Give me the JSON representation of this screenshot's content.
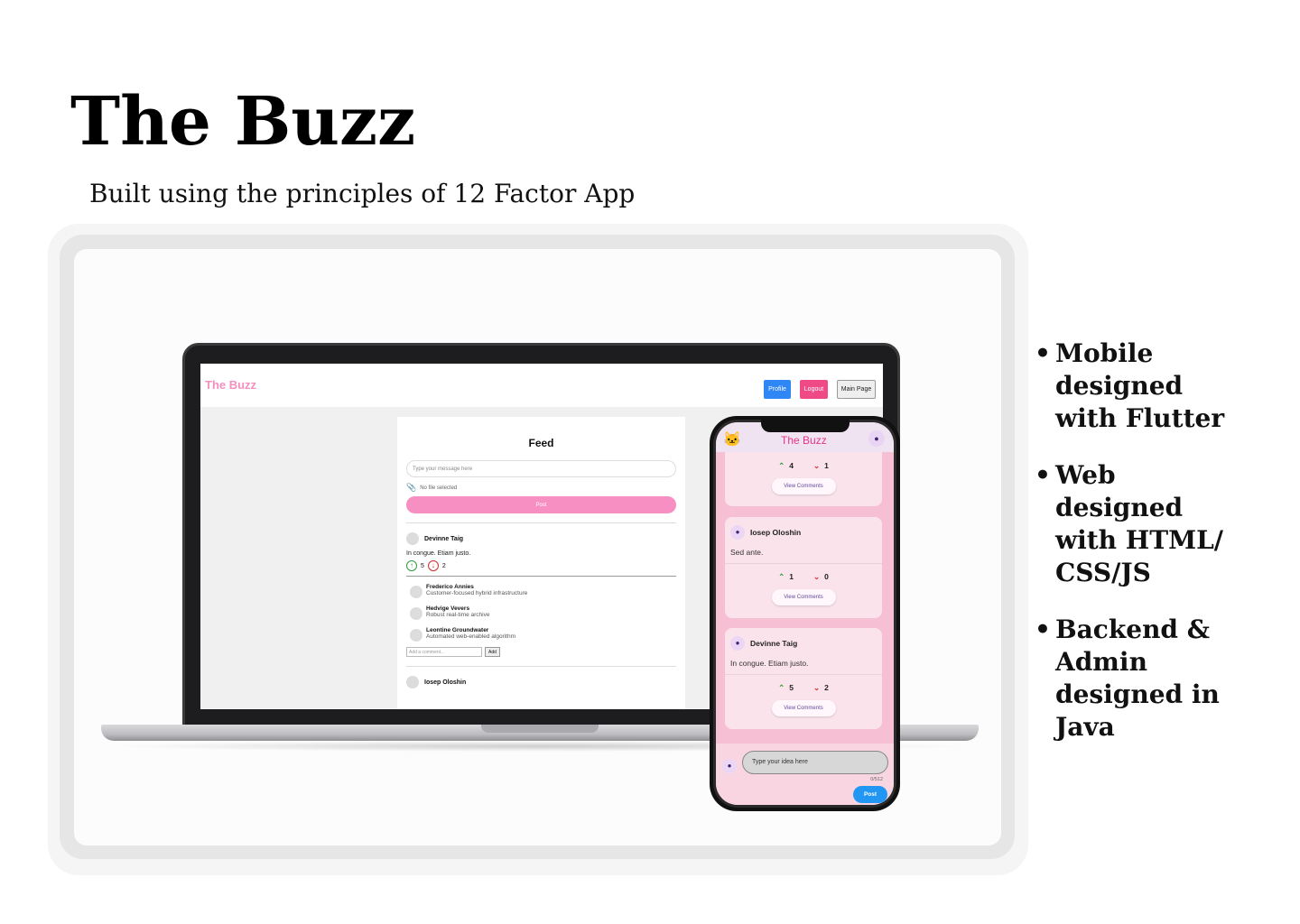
{
  "title": "The Buzz",
  "subtitle": "Built using the principles of 12 Factor App",
  "web": {
    "brand": "The Buzz",
    "buttons": {
      "profile": "Profile",
      "logout": "Logout",
      "main": "Main Page"
    },
    "feed": {
      "title": "Feed",
      "input_placeholder": "Type your message here",
      "file_status": "No file selected",
      "post_label": "Post",
      "post": {
        "author": "Devinne Taig",
        "body": "In congue. Etiam justo.",
        "upvotes": "5",
        "downvotes": "2"
      },
      "comments": [
        {
          "author": "Frederico Annies",
          "text": "Customer-focused hybrid infrastructure"
        },
        {
          "author": "Hedvige Vevers",
          "text": "Robust real-time archive"
        },
        {
          "author": "Leontine Groundwater",
          "text": "Automated web-enabled algorithm"
        }
      ],
      "add_comment_placeholder": "Add a comment...",
      "add_label": "Add",
      "next_author": "Iosep Oloshin"
    }
  },
  "mobile": {
    "app_title": "The Buzz",
    "cards": [
      {
        "author": "",
        "body": "",
        "up": "4",
        "down": "1",
        "view": "View Comments"
      },
      {
        "author": "Iosep Oloshin",
        "body": "Sed ante.",
        "up": "1",
        "down": "0",
        "view": "View Comments"
      },
      {
        "author": "Devinne Taig",
        "body": "In congue. Etiam justo.",
        "up": "5",
        "down": "2",
        "view": "View Comments"
      }
    ],
    "input_placeholder": "Type your idea here",
    "counter": "0/512",
    "post_label": "Post"
  },
  "bullets": [
    "Mobile\ndesigned\nwith Flutter",
    "Web\ndesigned\nwith HTML/\nCSS/JS",
    "Backend &\nAdmin\ndesigned in\nJava"
  ],
  "colors": {
    "brand_pink": "#f58fbf",
    "profile_blue": "#2f86f5",
    "logout_pink": "#f04a86",
    "phone_post_blue": "#2196f3"
  }
}
